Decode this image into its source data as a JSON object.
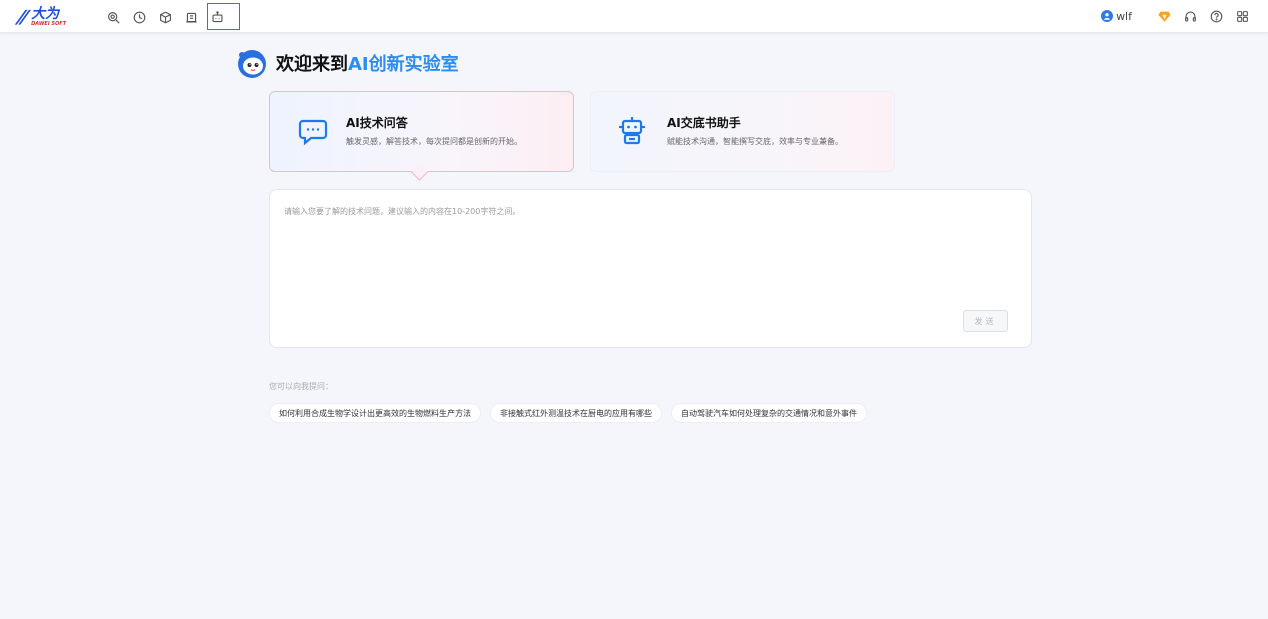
{
  "header": {
    "logo": {
      "mark": "∕∕",
      "cn": "大为",
      "en": "DAWEI SOFT"
    },
    "nav_icons": [
      "search-patent-icon",
      "clock-icon",
      "box-icon",
      "report-icon",
      "robot-icon"
    ],
    "active_nav": "robot-icon",
    "user": {
      "avatar": "①",
      "name": "wlf"
    },
    "right_icons": [
      "vip-diamond-icon",
      "headset-icon",
      "help-icon",
      "apps-grid-icon"
    ]
  },
  "welcome": {
    "prefix": "欢迎来到",
    "highlight": "AI创新实验室"
  },
  "cards": [
    {
      "title": "AI技术问答",
      "desc": "触发灵感，解答技术，每次提问都是创新的开始。",
      "icon": "chat-bubble-icon",
      "selected": true
    },
    {
      "title": "AI交底书助手",
      "desc": "赋能技术沟通，智能撰写交底，效率与专业兼备。",
      "icon": "robot-assistant-icon",
      "selected": false
    }
  ],
  "input": {
    "placeholder": "请输入您要了解的技术问题，建议输入的内容在10-200字符之间。",
    "value": "",
    "send_label": "发送"
  },
  "suggestions": {
    "label": "您可以向我提问：",
    "items": [
      "如何利用合成生物学设计出更高效的生物燃料生产方法",
      "非接触式红外测温技术在厨电的应用有哪些",
      "自动驾驶汽车如何处理复杂的交通情况和意外事件"
    ]
  },
  "colors": {
    "accent": "#2d8cf0",
    "brand": "#1f4fd8",
    "active_outline": "#e23b3b",
    "card_border_selected": "#f2b8c6"
  }
}
